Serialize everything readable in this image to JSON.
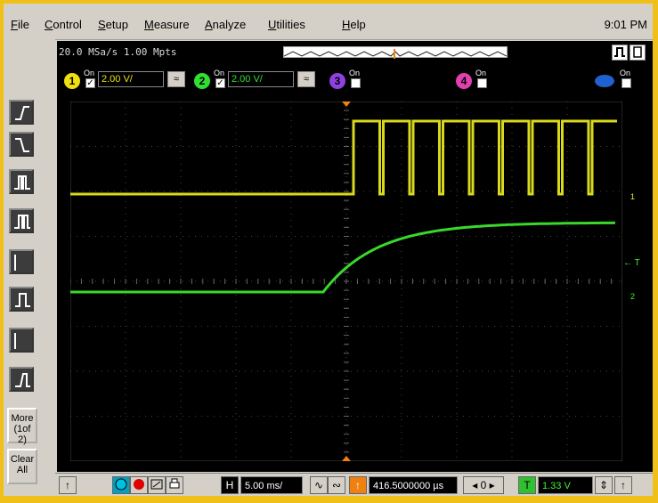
{
  "menu": {
    "items": [
      "File",
      "Control",
      "Setup",
      "Measure",
      "Analyze",
      "Utilities",
      "Help"
    ],
    "clock": "9:01 PM"
  },
  "acquisition": {
    "text": "20.0 MSa/s   1.00 Mpts"
  },
  "channels": [
    {
      "number": "1",
      "on_label": "On",
      "checked": true,
      "scale": "2.00 V/",
      "color": "#f0e010"
    },
    {
      "number": "2",
      "on_label": "On",
      "checked": true,
      "scale": "2.00 V/",
      "color": "#30e030"
    },
    {
      "number": "3",
      "on_label": "On",
      "checked": false,
      "color": "#9040e0"
    },
    {
      "number": "4",
      "on_label": "On",
      "checked": false,
      "color": "#e040b0"
    },
    {
      "number": "",
      "on_label": "On",
      "checked": false,
      "color": "#2060d0"
    }
  ],
  "left_toolbar": {
    "more_label": "More\n(1of 2)",
    "clear_label": "Clear\nAll"
  },
  "markers": {
    "ch1": "1",
    "t_label": "← T",
    "ch2": "2"
  },
  "bottom": {
    "h_label": "H",
    "timebase": "5.00 ms/",
    "delay_marker": "↑",
    "delay": "416.5000000 µs",
    "t_label": "T",
    "trigger_level": "1.33 V"
  },
  "colors": {
    "ch1_trace": "#f0f020",
    "ch2_trace": "#40f030",
    "grid": "#444444",
    "trigger_marker": "#f08010"
  }
}
